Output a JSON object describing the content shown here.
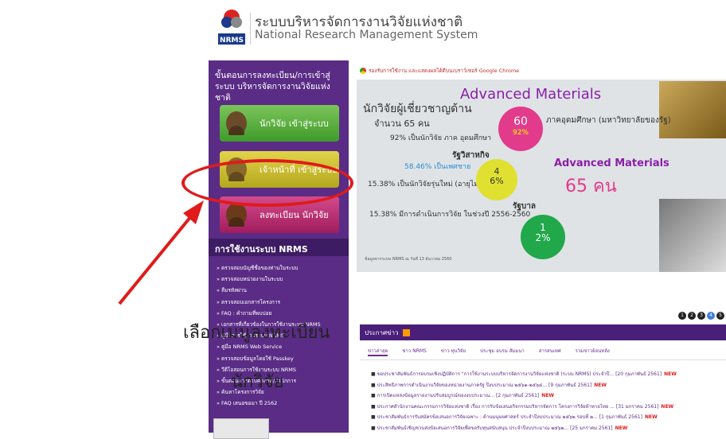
{
  "header": {
    "title_th": "ระบบบริหารจัดการงานวิจัยแห่งชาติ",
    "title_en": "National Research Management System",
    "logo_text": "NRMS"
  },
  "sidebar": {
    "heading": "ขั้นตอนการลงทะเบียน/การเข้าสู่ระบบ บริหารจัดการงานวิจัยแห่งชาติ",
    "buttons": [
      {
        "label": "นักวิจัย เข้าสู่ระบบ"
      },
      {
        "label": "เจ้าหน้าที่ เข้าสู่ระบบ"
      },
      {
        "label": "ลงทะเบียน นักวิจัย"
      }
    ],
    "usage_heading": "การใช้งานระบบ NRMS",
    "usage_items": [
      "ตรวจสอบบัญชีชื่อของท่านในระบบ",
      "ตรวจสอบหน่วยงานในระบบ",
      "ลืมรหัสผ่าน",
      "ตรวจสอบเอกสารโครงการ",
      "FAQ : คำถามที่พบบ่อย",
      "เอกสารที่เกี่ยวข้องในการใช้งานระบบ NRMS",
      "คู่มือการใช้งานระบบ NRMS",
      "คู่มือ NRMS Web Service",
      "ตรวจสอบข้อมูลโดยใช้ Passkey",
      "วีดีโอสอนการใช้งานระบบ NRMS",
      "ขั้นตอนการตอบคำถาม/สำนักการ",
      "ค้นหาโครงการวิจัย",
      "FAQ เสนอขอมา ปี 2562"
    ]
  },
  "annotation": {
    "line1": "เลือกเมนูลงทะเบียน",
    "line2": "นักวิจัย",
    "color": "#e11a1a"
  },
  "main": {
    "chrome_note": "รองรับการใช้งาน และแสดงผลได้ดีบนเบราว์เซอร์ Google Chrome",
    "banner": {
      "title": "Advanced Materials",
      "expert_title": "นักวิจัยผู้เชี่ยวชาญด้าน",
      "expert_count": "จำนวน 65 คน",
      "stat_92": "92% เป็นนักวิจัย ภาค อุดมศึกษา",
      "stat_58": "58.46% เป็นเพศชาย",
      "stat_15a": "15.38% เป็นนักวิจัยรุ่นใหม่ (อายุไม่เกิน 45 ปี)",
      "stat_15b": "15.38% มีการดำเนินการวิจัย ในช่วงปี 2556-2560",
      "pink_value": "60",
      "pink_pct": "92%",
      "academia": "ภาคอุดมศึกษา (มหาวิทยาลัยของรัฐ)",
      "private_label": "รัฐวิสาหกิจ",
      "yellow_value": "4",
      "yellow_pct": "6%",
      "gov_label": "รัฐบาล",
      "green_value": "1",
      "green_pct": "2%",
      "am_right": "Advanced Materials",
      "am_count": "65 คน",
      "footnote": "ข้อมูลจากระบบ NRMS ณ วันที่ 13 ธันวาคม 2560"
    },
    "pager": [
      "1",
      "2",
      "3",
      "4",
      "5"
    ],
    "news_heading": "ประกาศข่าว",
    "news_tabs": [
      "ข่าวล่าสุด",
      "ข่าว NRMS",
      "ข่าว ทุนวิจัย",
      "ประชุม อบรม สัมมนา",
      "สารสนเทศ",
      "รวมข่าวย้อนหลัง"
    ],
    "news_items": [
      {
        "text": "ขอประชาสัมพันธ์การอบรมเชิงปฏิบัติการ \"การใช้งานระบบบริหารจัดการงานวิจัยแห่งชาติ (ระบบ NRMS) ประจำปี... [20 กุมภาพันธ์ 2561]",
        "badge": "NEW"
      },
      {
        "text": "ประสิทธิภาพการดำเนินงานวิจัยของหน่วยงานภาครัฐ ปีงบประมาณ ๒๕๖๑-๒๕๖๔... [9 กุมภาพันธ์ 2561]",
        "badge": "NEW"
      },
      {
        "text": "การเปิดแหล่งข้อมูลรายงานปรับสมบูรณ์ของงบประมาณ... [2 กุมภาพันธ์ 2561]",
        "badge": "NEW"
      },
      {
        "text": "ประกาศสำนักงานคณะกรรมการวิจัยแห่งชาติ เรื่อง การรับข้อเสนอกิจกรรมบริหารจัดการ โครงการวิจัยท้าทายไทย ... [31 มกราคม 2561]",
        "badge": "NEW"
      },
      {
        "text": "ประชาสัมพันธ์การรับสมัครข้อเสนอการวิจัยเฉพาะ : ด้านมนุษยศาสตร์ ประจำปีงบประมาณ ๒๕๖๒ รอบที่ ๒... [1 กุมภาพันธ์ 2561]",
        "badge": "NEW"
      },
      {
        "text": "ประชาสัมพันธ์เชิญชวนส่งข้อเสนอการวิจัยเพื่อขอรับทุนสนับสนุน ประจำปีงบประมาณ ๒๕๖๒... [25 มกราคม 2561]",
        "badge": "NEW"
      }
    ]
  }
}
